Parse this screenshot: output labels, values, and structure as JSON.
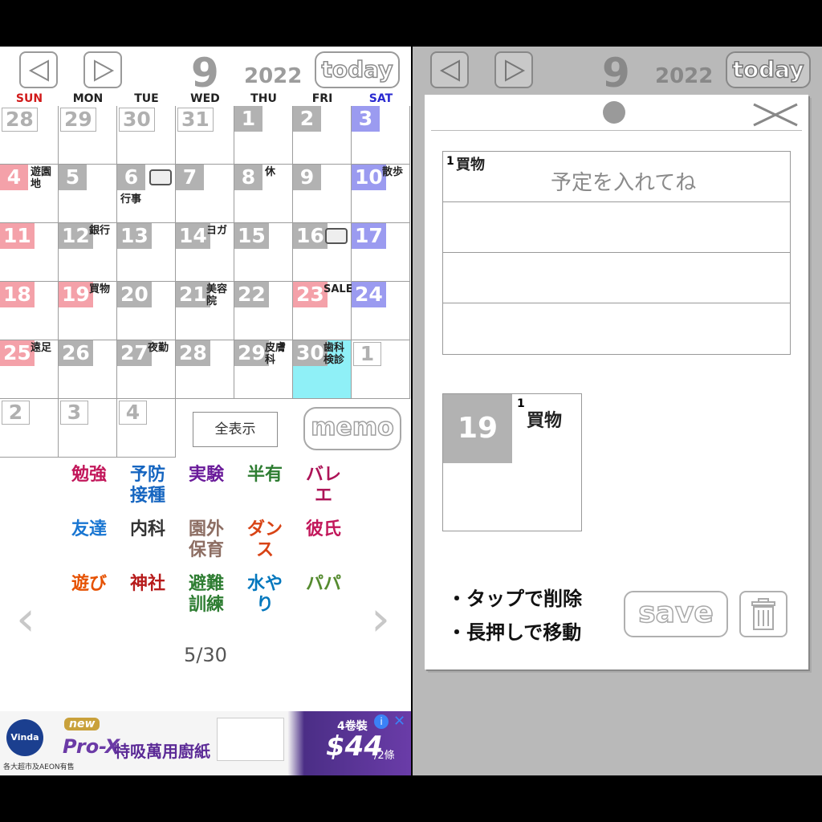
{
  "header": {
    "month": "9",
    "year": "2022",
    "today_label": "today"
  },
  "weekdays": [
    {
      "label": "SUN",
      "color": "#d11a1a"
    },
    {
      "label": "MON",
      "color": "#222222"
    },
    {
      "label": "TUE",
      "color": "#222222"
    },
    {
      "label": "WED",
      "color": "#222222"
    },
    {
      "label": "THU",
      "color": "#222222"
    },
    {
      "label": "FRI",
      "color": "#222222"
    },
    {
      "label": "SAT",
      "color": "#2a2ad1"
    }
  ],
  "calendar": {
    "weeks": [
      [
        {
          "day": "28",
          "type": "other"
        },
        {
          "day": "29",
          "type": "other"
        },
        {
          "day": "30",
          "type": "other"
        },
        {
          "day": "31",
          "type": "other"
        },
        {
          "day": "1",
          "type": "gray"
        },
        {
          "day": "2",
          "type": "gray"
        },
        {
          "day": "3",
          "type": "sat"
        }
      ],
      [
        {
          "day": "4",
          "type": "sun",
          "stamp": "遊園地"
        },
        {
          "day": "5",
          "type": "gray"
        },
        {
          "day": "6",
          "type": "gray",
          "stamp": "行事",
          "icon": "camera-icon"
        },
        {
          "day": "7",
          "type": "gray"
        },
        {
          "day": "8",
          "type": "gray",
          "stamp": "休"
        },
        {
          "day": "9",
          "type": "gray"
        },
        {
          "day": "10",
          "type": "sat",
          "stamp": "散歩"
        }
      ],
      [
        {
          "day": "11",
          "type": "sun"
        },
        {
          "day": "12",
          "type": "gray",
          "stamp": "銀行"
        },
        {
          "day": "13",
          "type": "gray"
        },
        {
          "day": "14",
          "type": "gray",
          "stamp": "ヨガ"
        },
        {
          "day": "15",
          "type": "gray"
        },
        {
          "day": "16",
          "type": "gray",
          "icon": "scissors-icon"
        },
        {
          "day": "17",
          "type": "sat"
        }
      ],
      [
        {
          "day": "18",
          "type": "sun"
        },
        {
          "day": "19",
          "type": "sun",
          "stamp": "買物"
        },
        {
          "day": "20",
          "type": "gray"
        },
        {
          "day": "21",
          "type": "gray",
          "stamp": "美容院"
        },
        {
          "day": "22",
          "type": "gray"
        },
        {
          "day": "23",
          "type": "sun",
          "stamp": "SALE"
        },
        {
          "day": "24",
          "type": "sat"
        }
      ],
      [
        {
          "day": "25",
          "type": "sun",
          "stamp": "遠足"
        },
        {
          "day": "26",
          "type": "gray"
        },
        {
          "day": "27",
          "type": "gray",
          "stamp": "夜勤"
        },
        {
          "day": "28",
          "type": "gray"
        },
        {
          "day": "29",
          "type": "gray",
          "stamp": "皮膚科"
        },
        {
          "day": "30",
          "type": "gray",
          "stamp": "歯科検診",
          "highlight": true
        },
        {
          "day": "1",
          "type": "other"
        }
      ],
      [
        {
          "day": "2",
          "type": "other"
        },
        {
          "day": "3",
          "type": "other"
        },
        {
          "day": "4",
          "type": "other"
        }
      ]
    ]
  },
  "controls": {
    "show_all_label": "全表示",
    "memo_label": "memo"
  },
  "stamp_palette": {
    "items": [
      {
        "text": "勉強",
        "color": "#c2185b"
      },
      {
        "text": "予防接種",
        "color": "#1565c0"
      },
      {
        "text": "実験",
        "color": "#6a1b9a"
      },
      {
        "text": "半有",
        "color": "#2e7d32"
      },
      {
        "text": "バレエ",
        "color": "#ad1457"
      },
      {
        "text": "友達",
        "color": "#1976d2"
      },
      {
        "text": "内科",
        "color": "#333333"
      },
      {
        "text": "園外保育",
        "color": "#8d6e63"
      },
      {
        "text": "ダンス",
        "color": "#d84315"
      },
      {
        "text": "彼氏",
        "color": "#c2185b"
      },
      {
        "text": "遊び",
        "color": "#e65100"
      },
      {
        "text": "神社",
        "color": "#b71c1c"
      },
      {
        "text": "避難訓練",
        "color": "#2e7d32"
      },
      {
        "text": "水やり",
        "color": "#0277bd"
      },
      {
        "text": "パパ",
        "color": "#558b2f"
      }
    ],
    "page": "5/30"
  },
  "ad": {
    "brand": "Vinda",
    "tag": "new",
    "product": "Pro-X",
    "title": "特吸萬用廚紙",
    "pack": "4卷裝",
    "price": "$44",
    "unit": "/2條",
    "footnote": "各大超市及AEON有售"
  },
  "editor": {
    "schedule_placeholder": "予定を入れてね",
    "entry_index": "1",
    "entry_stamp": "買物",
    "preview_day": "19",
    "hint_delete": "・タップで削除",
    "hint_move": "・長押しで移動",
    "save_label": "save"
  }
}
